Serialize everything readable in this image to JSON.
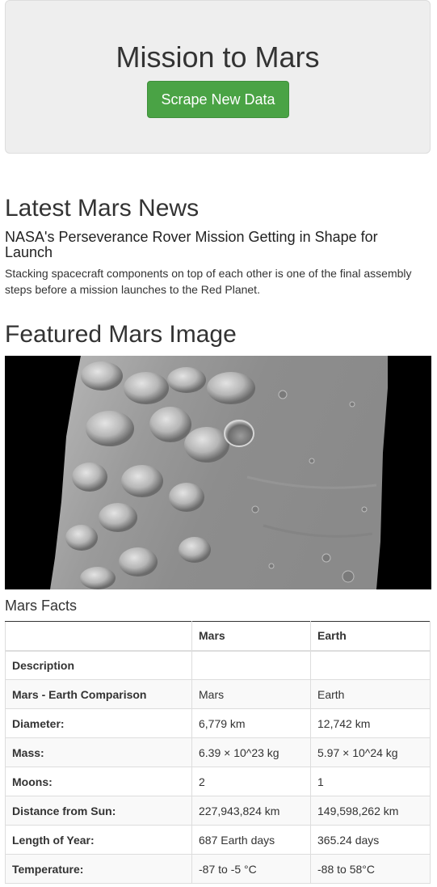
{
  "header": {
    "title": "Mission to Mars",
    "scrape_button_label": "Scrape New Data",
    "button_color": "#4aa345"
  },
  "news": {
    "section_title": "Latest Mars News",
    "headline": "NASA's Perseverance Rover Mission Getting in Shape for Launch",
    "teaser": "Stacking spacecraft components on top of each other is one of the final assembly steps before a mission launches to the Red Planet."
  },
  "featured": {
    "section_title": "Featured Mars Image"
  },
  "facts": {
    "section_title": "Mars Facts",
    "columns": [
      "",
      "Mars",
      "Earth"
    ],
    "rows": [
      {
        "label": "Description",
        "mars": "",
        "earth": ""
      },
      {
        "label": "Mars - Earth Comparison",
        "mars": "Mars",
        "earth": "Earth"
      },
      {
        "label": "Diameter:",
        "mars": "6,779 km",
        "earth": "12,742 km"
      },
      {
        "label": "Mass:",
        "mars": "6.39 × 10^23 kg",
        "earth": "5.97 × 10^24 kg"
      },
      {
        "label": "Moons:",
        "mars": "2",
        "earth": "1"
      },
      {
        "label": "Distance from Sun:",
        "mars": "227,943,824 km",
        "earth": "149,598,262 km"
      },
      {
        "label": "Length of Year:",
        "mars": "687 Earth days",
        "earth": "365.24 days"
      },
      {
        "label": "Temperature:",
        "mars": "-87 to -5 °C",
        "earth": "-88 to 58°C"
      }
    ]
  }
}
